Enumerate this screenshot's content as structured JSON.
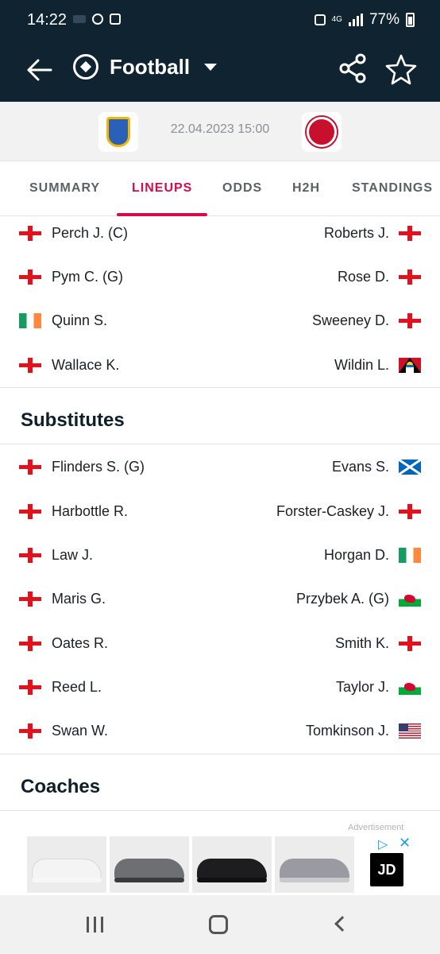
{
  "status_bar": {
    "time": "14:22",
    "network": "4G",
    "battery": "77%"
  },
  "app_bar": {
    "sport": "Football"
  },
  "match": {
    "datetime": "22.04.2023 15:00"
  },
  "tabs": [
    {
      "label": "SUMMARY",
      "active": false
    },
    {
      "label": "LINEUPS",
      "active": true
    },
    {
      "label": "ODDS",
      "active": false
    },
    {
      "label": "H2H",
      "active": false
    },
    {
      "label": "STANDINGS",
      "active": false
    }
  ],
  "lineup_rows": [
    {
      "home": {
        "name": "Perch J. (C)",
        "flag": "england"
      },
      "away": {
        "name": "Roberts J.",
        "flag": "england"
      }
    },
    {
      "home": {
        "name": "Pym C. (G)",
        "flag": "england"
      },
      "away": {
        "name": "Rose D.",
        "flag": "england"
      }
    },
    {
      "home": {
        "name": "Quinn S.",
        "flag": "ireland"
      },
      "away": {
        "name": "Sweeney D.",
        "flag": "england"
      }
    },
    {
      "home": {
        "name": "Wallace K.",
        "flag": "england"
      },
      "away": {
        "name": "Wildin L.",
        "flag": "antigua-and-barbuda"
      }
    }
  ],
  "substitutes": {
    "title": "Substitutes",
    "rows": [
      {
        "home": {
          "name": "Flinders S. (G)",
          "flag": "england"
        },
        "away": {
          "name": "Evans S.",
          "flag": "scotland"
        }
      },
      {
        "home": {
          "name": "Harbottle R.",
          "flag": "england"
        },
        "away": {
          "name": "Forster-Caskey J.",
          "flag": "england"
        }
      },
      {
        "home": {
          "name": "Law J.",
          "flag": "england"
        },
        "away": {
          "name": "Horgan D.",
          "flag": "ireland"
        }
      },
      {
        "home": {
          "name": "Maris G.",
          "flag": "england"
        },
        "away": {
          "name": "Przybek A. (G)",
          "flag": "wales"
        }
      },
      {
        "home": {
          "name": "Oates R.",
          "flag": "england"
        },
        "away": {
          "name": "Smith K.",
          "flag": "england"
        }
      },
      {
        "home": {
          "name": "Reed L.",
          "flag": "england"
        },
        "away": {
          "name": "Taylor J.",
          "flag": "wales"
        }
      },
      {
        "home": {
          "name": "Swan W.",
          "flag": "england"
        },
        "away": {
          "name": "Tomkinson J.",
          "flag": "usa"
        }
      }
    ]
  },
  "coaches": {
    "title": "Coaches"
  },
  "advertisement": {
    "label": "Advertisement",
    "brand": "JD"
  },
  "colors": {
    "header_bg": "#0f2430",
    "accent": "#d90a4a",
    "match_bg": "#f2f2f2"
  }
}
